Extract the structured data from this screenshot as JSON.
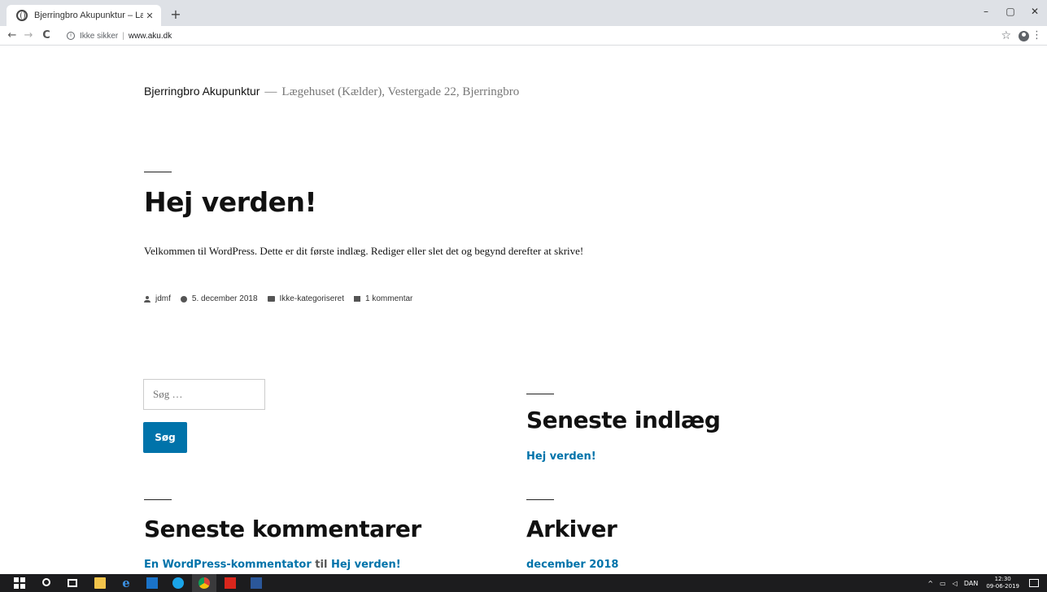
{
  "browser": {
    "tab_title": "Bjerringbro Akupunktur – Lægeh…",
    "tab_close": "✕",
    "new_tab": "+",
    "window_controls": [
      "–",
      "▢",
      "✕"
    ],
    "nav": {
      "back": "←",
      "forward": "→",
      "reload": "C"
    },
    "security_label": "Ikke sikker",
    "url": "www.aku.dk",
    "icons": [
      "globe-icon",
      "info-icon",
      "star-icon",
      "profile-icon",
      "menu-icon"
    ]
  },
  "site": {
    "title": "Bjerringbro Akupunktur",
    "separator": "—",
    "description": "Lægehuset (Kælder), Vestergade 22, Bjerringbro"
  },
  "post": {
    "title": "Hej verden!",
    "body": "Velkommen til WordPress. Dette er dit første indlæg. Rediger eller slet det og begynd derefter at skrive!",
    "meta": {
      "author": "jdmf",
      "date": "5. december 2018",
      "category": "Ikke-kategoriseret",
      "comments": "1 kommentar"
    }
  },
  "search": {
    "placeholder": "Søg …",
    "button_label": "Søg"
  },
  "widgets": {
    "recent_posts": {
      "title": "Seneste indlæg",
      "items": [
        "Hej verden!"
      ]
    },
    "recent_comments": {
      "title": "Seneste kommentarer",
      "author": "En WordPress-kommentator",
      "connector": "til",
      "post": "Hej verden!"
    },
    "archives": {
      "title": "Arkiver",
      "items": [
        "december 2018"
      ]
    }
  },
  "taskbar": {
    "apps": [
      "windows-icon",
      "search-icon",
      "task-view-icon",
      "file-explorer-icon",
      "edge-icon",
      "outlook-icon",
      "skype-icon",
      "chrome-icon",
      "acrobat-icon",
      "word-icon"
    ],
    "tray": {
      "chevron": "^",
      "language": "DAN",
      "time": "12:30",
      "date": "09-06-2019"
    }
  },
  "colors": {
    "link": "#0073aa",
    "button": "#0073aa",
    "taskbar": "#1c1c1e",
    "tabbar": "#dee1e6"
  }
}
